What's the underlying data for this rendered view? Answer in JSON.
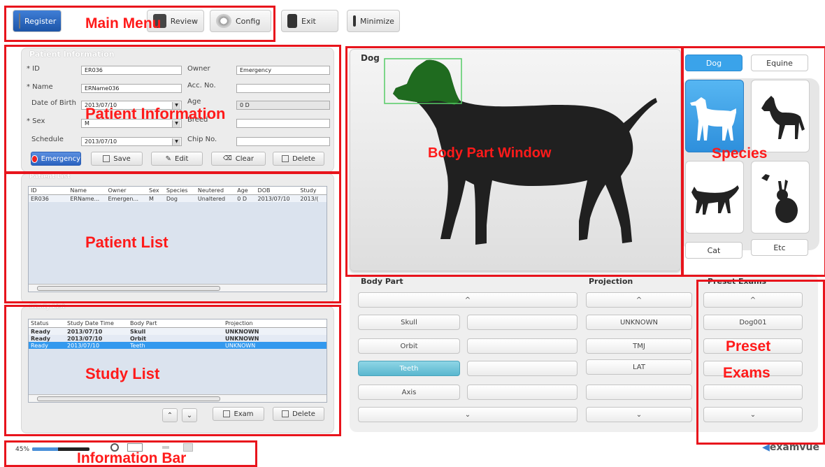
{
  "menu": {
    "register": "Register",
    "review": "Review",
    "config": "Config",
    "exit": "Exit",
    "minimize": "Minimize"
  },
  "patient_info": {
    "title": "Patient Information",
    "id_label": "* ID",
    "id_value": "ER036",
    "name_label": "* Name",
    "name_value": "ERName036",
    "dob_label": "Date of Birth",
    "dob_value": "2013/07/10",
    "sex_label": "* Sex",
    "sex_value": "M",
    "schedule_label": "Schedule",
    "schedule_value": "2013/07/10",
    "owner_label": "Owner",
    "owner_value": "Emergency",
    "acc_label": "Acc. No.",
    "age_label": "Age",
    "age_value": "0 D",
    "breed_label": "Breed",
    "chip_label": "Chip No.",
    "buttons": {
      "emergency": "Emergency",
      "save": "Save",
      "edit": "Edit",
      "clear": "Clear",
      "delete": "Delete"
    }
  },
  "patient_list": {
    "title": "Patient List",
    "columns": [
      "ID",
      "Name",
      "Owner",
      "Sex",
      "Species",
      "Neutered",
      "Age",
      "DOB",
      "Study"
    ],
    "rows": [
      [
        "ER036",
        "ERName...",
        "Emergen...",
        "M",
        "Dog",
        "Unaltered",
        "0 D",
        "2013/07/10",
        "2013/("
      ]
    ]
  },
  "study_list": {
    "title": "Study List",
    "columns": [
      "Status",
      "Study Date Time",
      "Body Part",
      "Projection"
    ],
    "rows": [
      [
        "Ready",
        "2013/07/10",
        "Skull",
        "UNKNOWN"
      ],
      [
        "Ready",
        "2013/07/10",
        "Orbit",
        "UNKNOWN"
      ],
      [
        "Ready",
        "2013/07/10",
        "Teeth",
        "UNKNOWN"
      ]
    ],
    "buttons": {
      "exam": "Exam",
      "delete": "Delete"
    }
  },
  "body_window": {
    "species_label": "Dog"
  },
  "species": {
    "tab_dog": "Dog",
    "tab_equine": "Equine",
    "tab_cat": "Cat",
    "tab_etc": "Etc"
  },
  "body_part": {
    "title": "Body Part",
    "items": [
      "Skull",
      "Orbit",
      "Teeth",
      "Axis"
    ],
    "selected": "Teeth"
  },
  "projection": {
    "title": "Projection",
    "items": [
      "UNKNOWN",
      "TMJ",
      "LAT"
    ]
  },
  "preset": {
    "title": "Preset Exams",
    "items": [
      "Dog001"
    ]
  },
  "info_bar": {
    "percent": "45%",
    "progress": 0.45
  },
  "brand": "examvue",
  "annotations": {
    "main_menu": "Main Menu",
    "patient_information": "Patient Information",
    "patient_list": "Patient List",
    "study_list": "Study List",
    "information_bar": "Information Bar",
    "body_part_window": "Body Part Window",
    "species": "Species",
    "preset_exams_1": "Preset",
    "preset_exams_2": "Exams"
  },
  "colors": {
    "annotation": "#e8141c",
    "selected": "#5ab7cf",
    "species_selected": "#3aa3ea"
  }
}
